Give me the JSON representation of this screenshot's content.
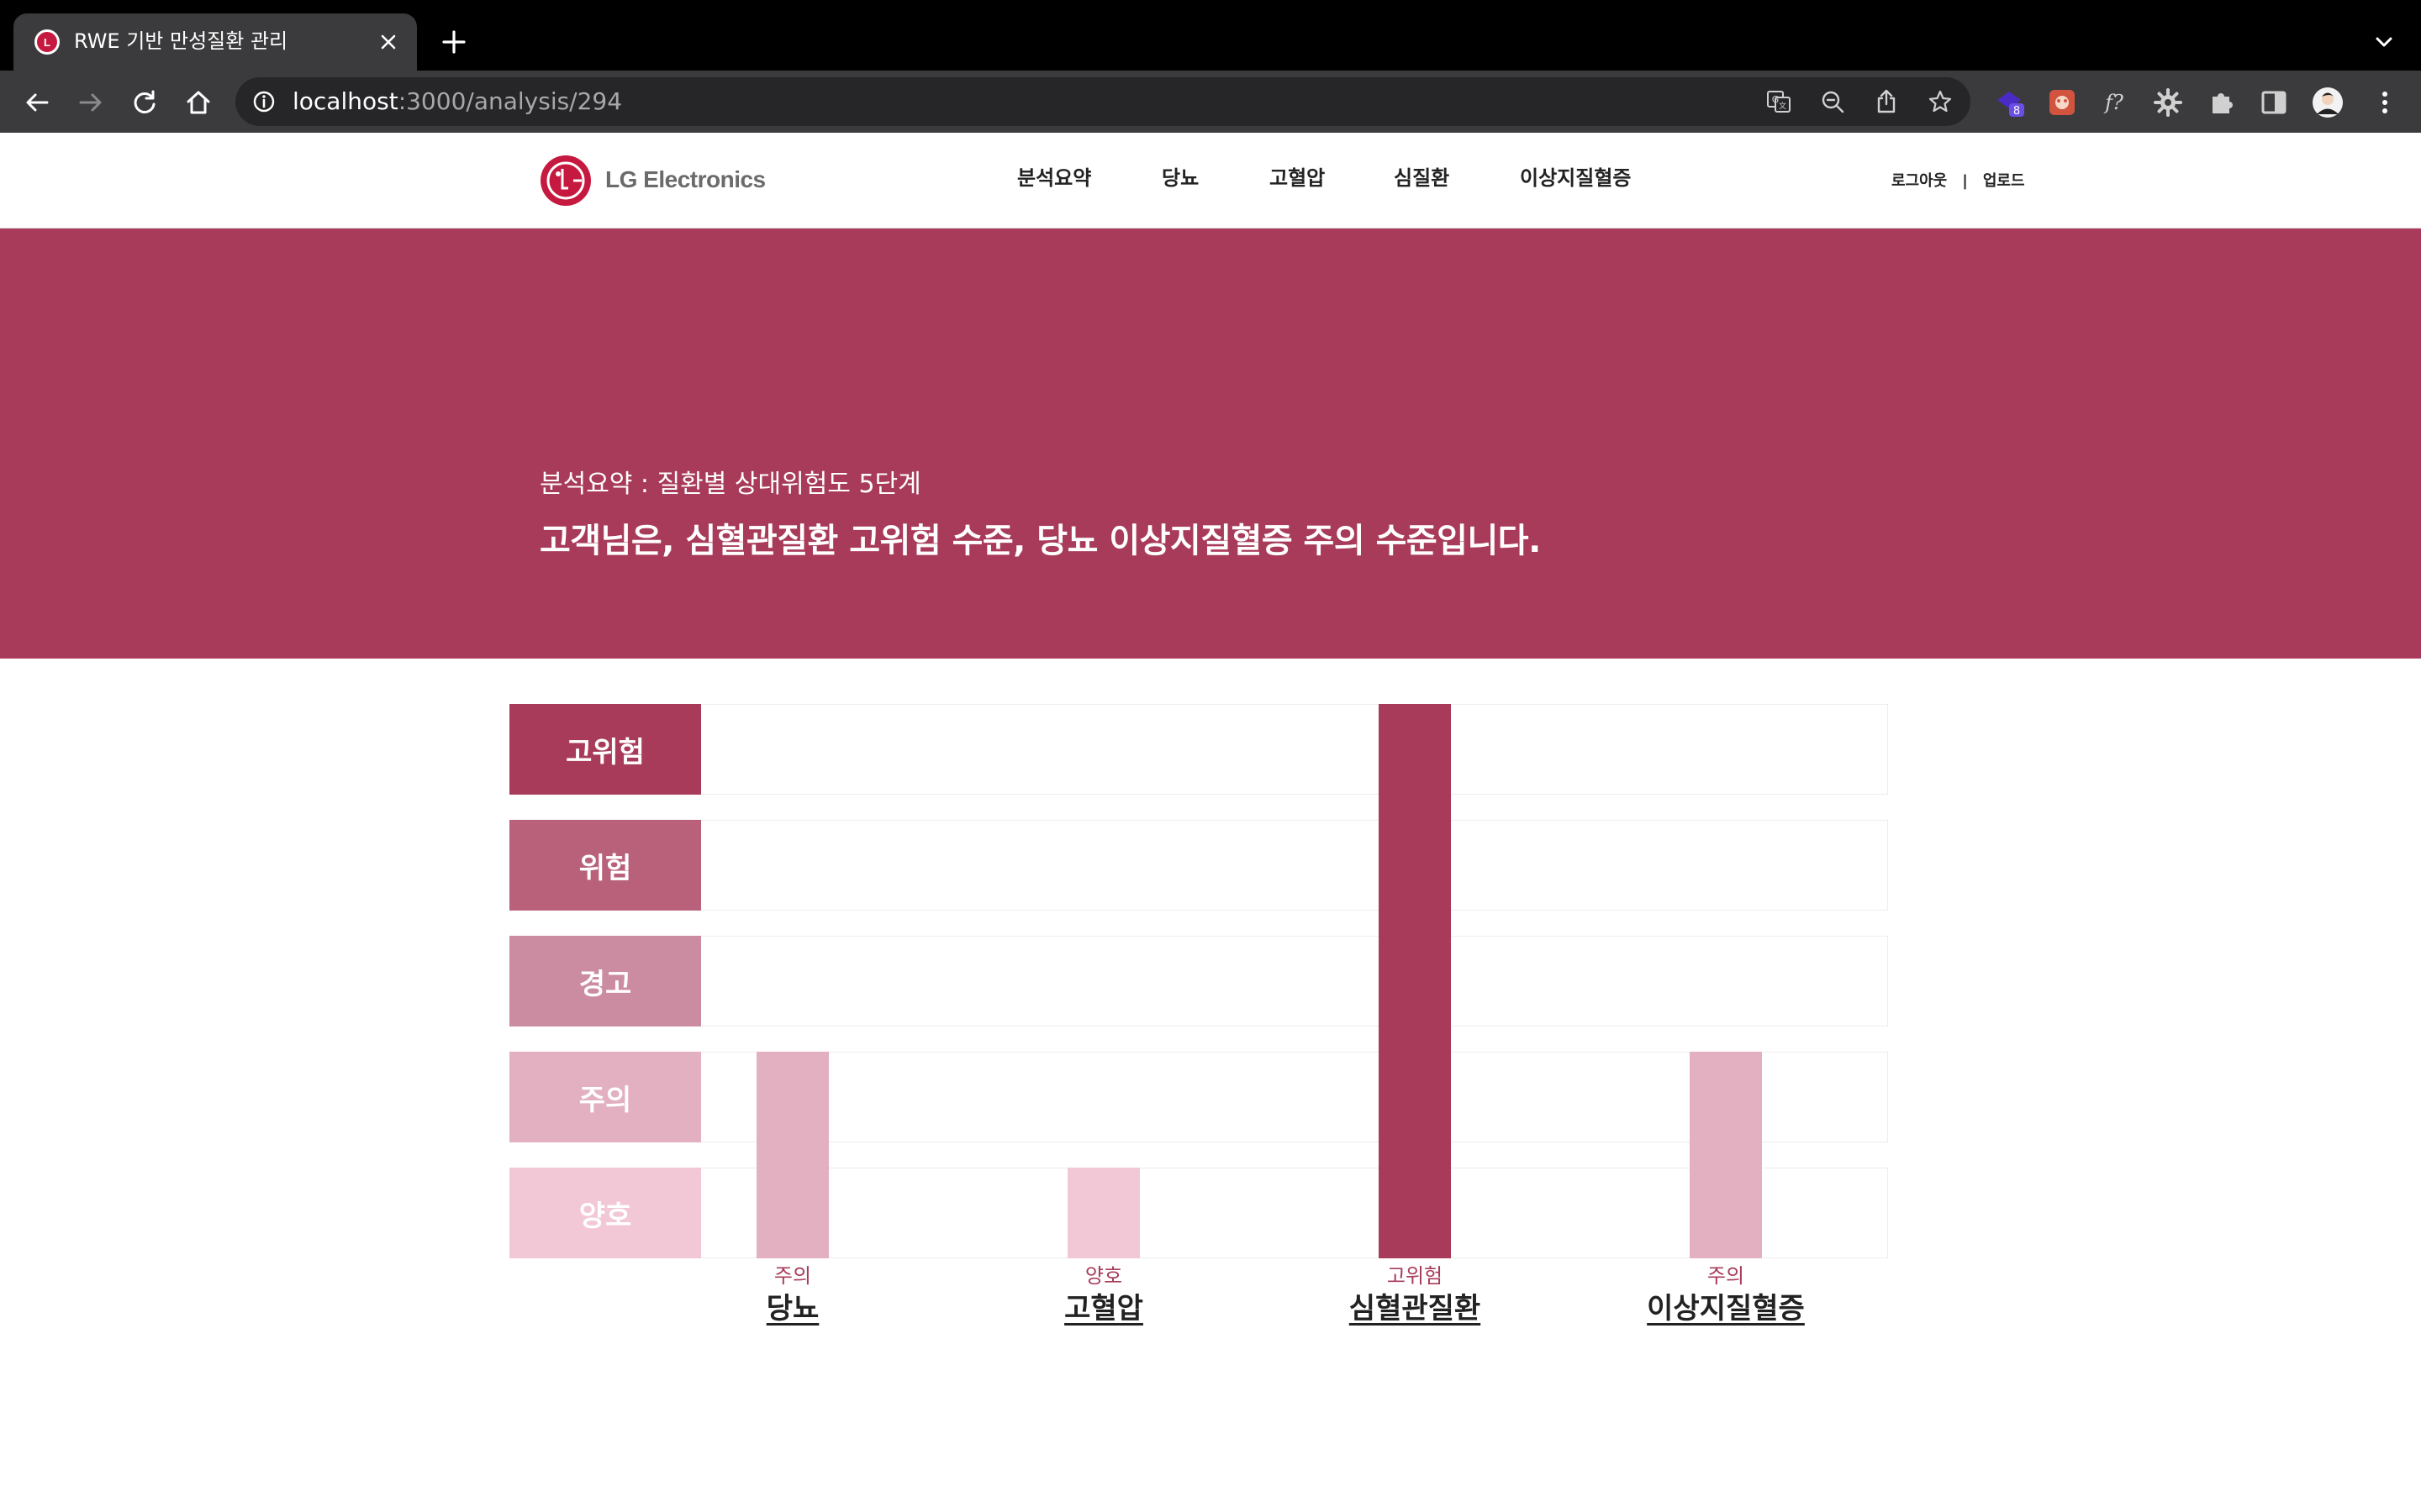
{
  "browser": {
    "tab_title": "RWE 기반 만성질환 관리",
    "url_host": "localhost",
    "url_path": ":3000/analysis/294",
    "extension_badge": "8",
    "extension_formula": "f?"
  },
  "header": {
    "logo_text": "LG Electronics",
    "nav": [
      "분석요약",
      "당뇨",
      "고혈압",
      "심질환",
      "이상지질혈증"
    ],
    "auth": {
      "logout": "로그아웃",
      "separator": "|",
      "upload": "업로드"
    }
  },
  "hero": {
    "subtitle": "분석요약 : 질환별 상대위험도 5단계",
    "title": "고객님은, 심혈관질환 고위험 수준, 당뇨 이상지질혈증 주의 수준입니다.",
    "background_color": "#a83b5a"
  },
  "chart_data": {
    "type": "bar",
    "levels": [
      "고위험",
      "위험",
      "경고",
      "주의",
      "양호"
    ],
    "level_colors": [
      "#a83b5a",
      "#b9607b",
      "#cb8ba0",
      "#e2b0c0",
      "#f3c8d6"
    ],
    "categories": [
      "당뇨",
      "고혈압",
      "심혈관질환",
      "이상지질혈증"
    ],
    "values": [
      "주의",
      "양호",
      "고위험",
      "주의"
    ]
  }
}
